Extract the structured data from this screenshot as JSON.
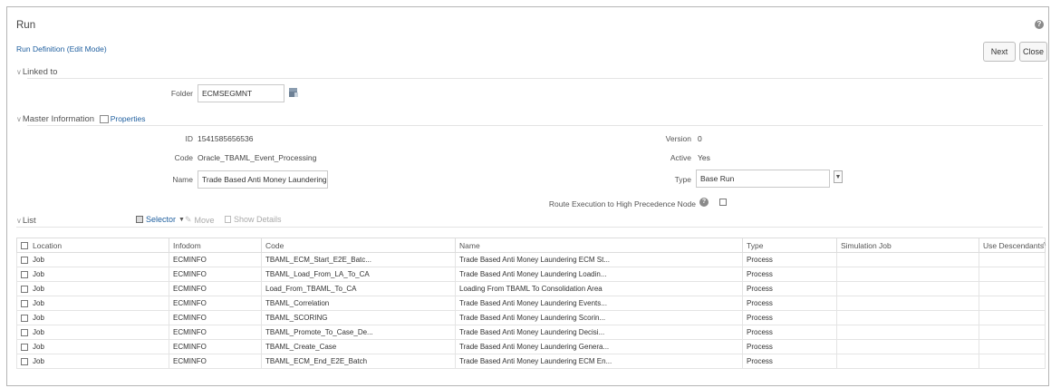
{
  "header": {
    "title": "Run",
    "subtitle": "Run Definition (Edit Mode)",
    "next_label": "Next",
    "close_label": "Close",
    "help_glyph": "?"
  },
  "linked": {
    "section_label": "Linked to",
    "folder_label": "Folder",
    "folder_value": "ECMSEGMNT"
  },
  "master": {
    "section_label": "Master Information",
    "properties_label": "Properties",
    "id_label": "ID",
    "id_value": "1541585656536",
    "code_label": "Code",
    "code_value": "Oracle_TBAML_Event_Processing",
    "name_label": "Name",
    "name_value": "Trade Based Anti Money Laundering E",
    "version_label": "Version",
    "version_value": "0",
    "active_label": "Active",
    "active_value": "Yes",
    "type_label": "Type",
    "type_value": "Base Run",
    "route_label": "Route Execution to High Precedence Node"
  },
  "list": {
    "section_label": "List",
    "toolbar": {
      "selector": "Selector",
      "move": "Move",
      "show_details": "Show Details"
    },
    "columns": [
      "Location",
      "Infodom",
      "Code",
      "Name",
      "Type",
      "Simulation Job",
      "Use Descendants"
    ],
    "rows": [
      {
        "location": "Job",
        "infodom": "ECMINFO",
        "code": "TBAML_ECM_Start_E2E_Batc...",
        "name": "Trade Based Anti Money Laundering ECM St...",
        "type": "Process",
        "sim": "",
        "desc": ""
      },
      {
        "location": "Job",
        "infodom": "ECMINFO",
        "code": "TBAML_Load_From_LA_To_CA",
        "name": "Trade Based Anti Money Laundering Loadin...",
        "type": "Process",
        "sim": "",
        "desc": ""
      },
      {
        "location": "Job",
        "infodom": "ECMINFO",
        "code": "Load_From_TBAML_To_CA",
        "name": "Loading From TBAML To Consolidation Area",
        "type": "Process",
        "sim": "",
        "desc": ""
      },
      {
        "location": "Job",
        "infodom": "ECMINFO",
        "code": "TBAML_Correlation",
        "name": "Trade Based Anti Money Laundering Events...",
        "type": "Process",
        "sim": "",
        "desc": ""
      },
      {
        "location": "Job",
        "infodom": "ECMINFO",
        "code": "TBAML_SCORING",
        "name": "Trade Based Anti Money Laundering Scorin...",
        "type": "Process",
        "sim": "",
        "desc": ""
      },
      {
        "location": "Job",
        "infodom": "ECMINFO",
        "code": "TBAML_Promote_To_Case_De...",
        "name": "Trade Based Anti Money Laundering Decisi...",
        "type": "Process",
        "sim": "",
        "desc": ""
      },
      {
        "location": "Job",
        "infodom": "ECMINFO",
        "code": "TBAML_Create_Case",
        "name": "Trade Based Anti Money Laundering Genera...",
        "type": "Process",
        "sim": "",
        "desc": ""
      },
      {
        "location": "Job",
        "infodom": "ECMINFO",
        "code": "TBAML_ECM_End_E2E_Batch",
        "name": "Trade Based Anti Money Laundering ECM En...",
        "type": "Process",
        "sim": "",
        "desc": ""
      }
    ]
  },
  "colors": {
    "link": "#1f5f9f",
    "border": "#b5b5b5"
  }
}
